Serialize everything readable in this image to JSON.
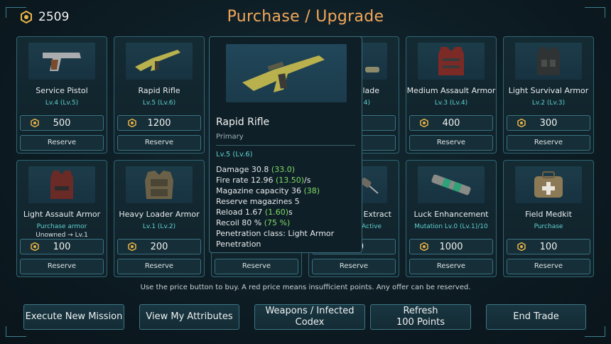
{
  "header": {
    "points": "2509",
    "title": "Purchase / Upgrade"
  },
  "colors": {
    "accent": "#f2a75a",
    "level": "#5fd0cf",
    "bonus": "#7fdc67",
    "panel_border": "#2f6573"
  },
  "cards": [
    {
      "name": "Service Pistol",
      "level": "Lv.4 (Lv.5)",
      "price": "500",
      "reserve": "Reserve",
      "icon": "pistol-icon"
    },
    {
      "name": "Rapid Rifle",
      "level": "Lv.5 (Lv.6)",
      "price": "1200",
      "reserve": "Reserve",
      "icon": "rifle-icon"
    },
    {
      "name": "",
      "level": "",
      "price": "",
      "reserve": "",
      "icon": "weapon-icon"
    },
    {
      "name": "lade",
      "level": "4)",
      "price": "",
      "reserve": "",
      "icon": "blade-icon"
    },
    {
      "name": "Medium Assault Armor",
      "level": "Lv.3 (Lv.4)",
      "price": "400",
      "reserve": "Reserve",
      "icon": "armor-vest-icon"
    },
    {
      "name": "Light Survival Armor",
      "level": "Lv.2 (Lv.3)",
      "price": "300",
      "reserve": "Reserve",
      "icon": "armor-vest-icon"
    },
    {
      "name": "Light Assault Armor",
      "level": "Purchase armor",
      "level2": "Unowned → Lv.1",
      "price": "100",
      "reserve": "Reserve",
      "icon": "armor-vest-icon"
    },
    {
      "name": "Heavy Loader Armor",
      "level": "Lv.1 (Lv.2)",
      "price": "200",
      "reserve": "Reserve",
      "icon": "heavy-armor-icon"
    },
    {
      "name": "",
      "level": "",
      "price": "",
      "reserve": "Reserve",
      "icon": "item-icon"
    },
    {
      "name": "Extract",
      "level": "Active",
      "price": "0",
      "reserve": "Reserve",
      "icon": "syringe-icon"
    },
    {
      "name": "Luck Enhancement",
      "level": "Mutation Lv.0 (Lv.1)/10",
      "price": "1000",
      "reserve": "Reserve",
      "icon": "serum-canister-icon"
    },
    {
      "name": "Field Medkit",
      "level": "Purchase",
      "price": "100",
      "reserve": "Reserve",
      "icon": "medkit-icon"
    }
  ],
  "tooltip": {
    "name": "Rapid Rifle",
    "category": "Primary",
    "level": "Lv.5 (Lv.6)",
    "stats": [
      {
        "label": "Damage 30.8 ",
        "bonus": "(33.0)",
        "suffix": ""
      },
      {
        "label": "Fire rate 12.96 ",
        "bonus": "(13.50)",
        "suffix": "/s"
      },
      {
        "label": "Magazine capacity 36 ",
        "bonus": "(38)",
        "suffix": ""
      },
      {
        "label": "Reserve magazines 5",
        "bonus": "",
        "suffix": ""
      },
      {
        "label": "Reload 1.67 ",
        "bonus": "(1.60)",
        "suffix": "s"
      },
      {
        "label": "Recoil 80 % ",
        "bonus": "(75 %)",
        "suffix": ""
      },
      {
        "label": "Penetration class: Light Armor",
        "bonus": "",
        "suffix": ""
      },
      {
        "label": "Penetration",
        "bonus": "",
        "suffix": ""
      }
    ]
  },
  "hint": "Use the price button to buy. A red price means insufficient points. Any offer can be reserved.",
  "buttons": [
    {
      "label": "Execute New Mission"
    },
    {
      "label": "View My Attributes"
    },
    {
      "label": "Weapons / Infected Codex"
    },
    {
      "label": "Refresh",
      "label2": "100 Points"
    },
    {
      "label": "End Trade"
    }
  ]
}
